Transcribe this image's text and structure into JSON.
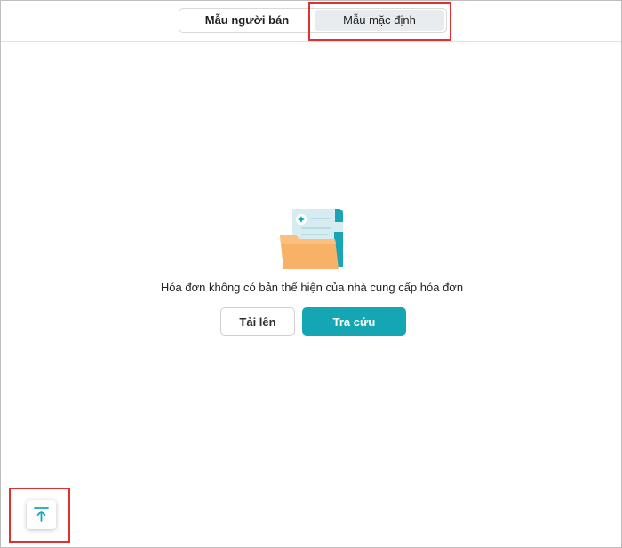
{
  "tabs": {
    "seller_template": "Mẫu người bán",
    "default_template": "Mẫu mặc định",
    "active": "default_template"
  },
  "empty_state": {
    "icon": "folder-document-icon",
    "message": "Hóa đơn không có bản thể hiện của nhà cung cấp hóa đơn"
  },
  "actions": {
    "upload_label": "Tải lên",
    "lookup_label": "Tra cứu"
  },
  "floating": {
    "icon": "arrow-up-to-top-icon"
  },
  "colors": {
    "accent": "#14a6b3",
    "highlight": "#e03131",
    "active_tab_bg": "#e9ecef"
  }
}
